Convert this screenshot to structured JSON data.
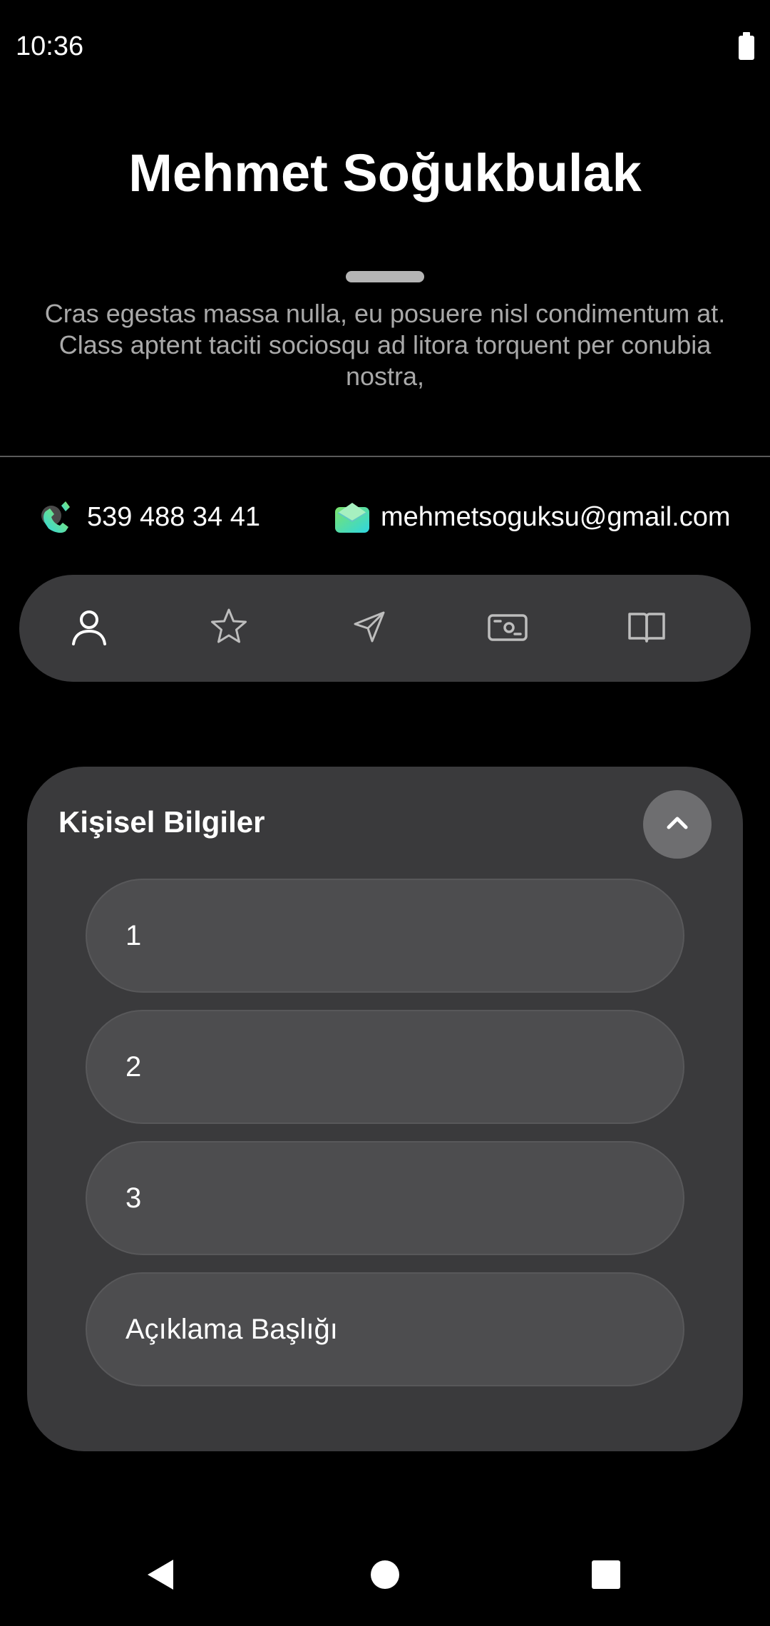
{
  "status_bar": {
    "time": "10:36"
  },
  "profile": {
    "name": "Mehmet Soğukbulak",
    "description_line1": "Cras egestas massa nulla, eu posuere nisl condimentum at.",
    "description_line2": "Class aptent taciti sociosqu ad litora torquent per conubia nostra,"
  },
  "contacts": {
    "phone": "539 488 34 41",
    "phone_icon": "phone-icon",
    "email": "mehmetsoguksu@gmail.com",
    "email_icon": "mail-icon"
  },
  "tabs": [
    {
      "icon": "user-icon",
      "active": true
    },
    {
      "icon": "star-icon",
      "active": false
    },
    {
      "icon": "send-icon",
      "active": false
    },
    {
      "icon": "money-icon",
      "active": false
    },
    {
      "icon": "book-icon",
      "active": false
    }
  ],
  "section": {
    "title": "Kişisel Bilgiler",
    "expanded": true,
    "fields": [
      {
        "value": "1"
      },
      {
        "value": "2"
      },
      {
        "value": "3"
      },
      {
        "value": "Açıklama Başlığı"
      }
    ]
  },
  "colors": {
    "background": "#000000",
    "surface": "#3a3a3c",
    "field": "#4d4d4f",
    "muted_text": "#a9a9a9",
    "accent_teal": "#3ddbd0",
    "accent_green": "#7be36b"
  }
}
